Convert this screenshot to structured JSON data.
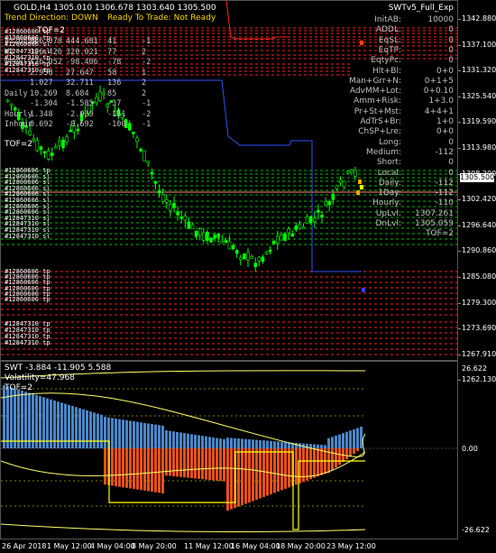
{
  "chart_title": "GOLD,H4  1305.010 1306.678 1303.640 1305.500",
  "indicator_name": "SWTv5_Full_Exp",
  "status": {
    "trend_direction": "Trend Direction: DOWN",
    "ready": "Ready To Trade: Not Ready"
  },
  "tof_label_top": "TOF=2",
  "tof_label_mid": "TOF=2",
  "left_table": [
    [
      "#126899",
      "386.078",
      "444.681",
      "41",
      "-1"
    ],
    [
      "W1",
      "126.426",
      "320.021",
      "77",
      "2"
    ],
    [
      "Weekly",
      "126.052",
      "-98.406",
      "-78",
      "-2"
    ],
    [
      "",
      "2.958",
      "27.647",
      "58",
      "1"
    ],
    [
      "",
      "1.027",
      "32.711",
      "136",
      "2"
    ],
    [
      "Daily",
      "10.269",
      "8.684",
      "85",
      "2"
    ],
    [
      "",
      "-1.304",
      "-1.585",
      "-37",
      "-1"
    ],
    [
      "Hourly",
      "1.348",
      "-2.039",
      "-151",
      "-2"
    ],
    [
      "Inhour",
      "0.692",
      "-0.692",
      "-100",
      "-1"
    ]
  ],
  "stats": [
    [
      "InitAB:",
      "10000"
    ],
    [
      "ADDL:",
      "0"
    ],
    [
      "EqSL:",
      "0"
    ],
    [
      "EqTP:",
      "0"
    ],
    [
      "EqtyPc:",
      "0"
    ],
    [
      "Hlt+Bl:",
      "0+0"
    ],
    [
      "Man+Grr+N:",
      "0+1+5"
    ],
    [
      "AdvMM+Lot:",
      "0+0.10"
    ],
    [
      "Amm+Risk:",
      "1+3.0"
    ],
    [
      "Pr+St+Mst:",
      "4+4+1"
    ],
    [
      "AdTrS+Br:",
      "1+0"
    ],
    [
      "ChSP+Lre:",
      "0+0"
    ],
    [
      "Long:",
      "0"
    ],
    [
      "Medium:",
      "-112"
    ],
    [
      "Short:",
      "0"
    ],
    [
      "Local:",
      "0"
    ],
    [
      "Daily:",
      "-112"
    ],
    [
      "1Day:",
      "-112"
    ],
    [
      "Hourly:",
      "-110"
    ],
    [
      "UpLvl:",
      "1307.261"
    ],
    [
      "DnLvl:",
      "1305.059"
    ],
    [
      "",
      "TOF=2"
    ]
  ],
  "price_axis": [
    "1342.880",
    "1337.100",
    "1331.320",
    "1325.540",
    "1319.590",
    "1313.980",
    "1308.200",
    "1302.420",
    "1296.640",
    "1290.860",
    "1285.080",
    "1279.300",
    "1273.690",
    "1267.910",
    "1262.130"
  ],
  "current_price": "1305.500",
  "order_labels_green": [
    "#12860606 tp",
    "#12860606 sl",
    "#12860606 sl",
    "#12860606 sl",
    "#12860606 sl",
    "#12860606 sl",
    "#12860606 sl",
    "#12860606 sl",
    "#12847310 sl",
    "#12847310 sl",
    "#12847310 sl",
    "#12847310 sl"
  ],
  "order_labels_red": [
    "#12860606 tp",
    "#12860606 tp",
    "#12860606 tp",
    "#12860606 tp",
    "#12860606 tp",
    "#12860606 tp",
    "#12847310 tp",
    "#12847310 tp",
    "#12847310 tp",
    "#12847310 tp"
  ],
  "order_labels_top": [
    "#12860606 tp",
    "#12860606 tp",
    "#12860606 sl",
    "#12847310 sl",
    "#12847310 tp",
    "#12847310 tp",
    "#12847310 tp"
  ],
  "sub_title": "SWT -3.884 -11.905 5.588",
  "volatility": "Volatility=47.968",
  "sub_tof": "TOF=2",
  "sub_axis": [
    "26.622",
    "0.00",
    "-26.622"
  ],
  "time_axis": [
    "26 Apr 2018",
    "1 May 12:00",
    "4 May 04:00",
    "8 May 20:00",
    "11 May 12:00",
    "16 May 04:00",
    "18 May 20:00",
    "23 May 12:00"
  ],
  "colors": {
    "bull": "#00ff00",
    "bear": "#000000",
    "trend_text": "#ffd700",
    "red_line": "#ff2020",
    "green_line": "#00c000",
    "blue_line": "#3050ff",
    "hist_blue": "#4a86c8",
    "hist_orange": "#e8501a",
    "yellow": "#ffff00"
  }
}
